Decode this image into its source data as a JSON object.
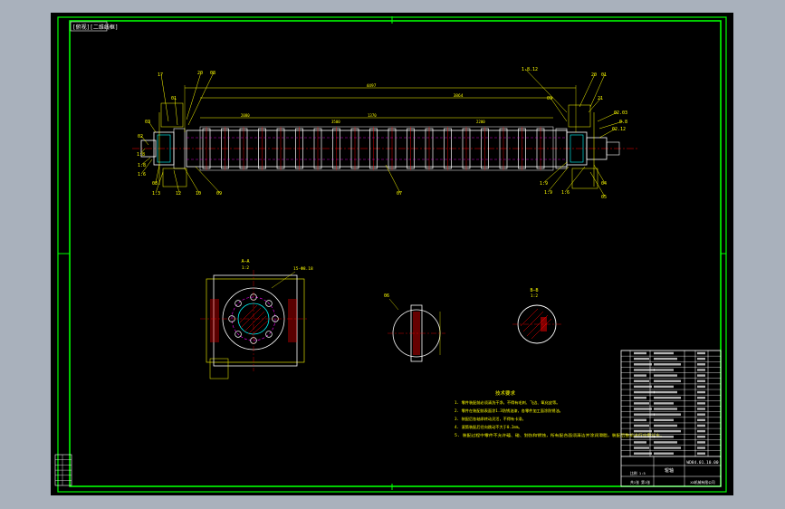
{
  "frame_label": "[俯视][二维线框]",
  "part_labels": [
    "17",
    "20",
    "08",
    "01",
    "03",
    "02",
    "1.8",
    "1.6",
    "08",
    "1.3",
    "12",
    "10",
    "09",
    "07",
    "1.9",
    "1.9",
    "1.6",
    "04",
    "05",
    "20",
    "21",
    "02.03",
    "0.8",
    "1.8.12",
    "09",
    "01",
    "02.12",
    "1.8"
  ],
  "dimensions": {
    "overall_length": "4497",
    "roller_length": "3864",
    "small_dims": [
      "2080",
      "1370",
      "3500",
      "2200"
    ]
  },
  "section_views": {
    "a_a_label": "A—A",
    "a_a_scale": "1:2",
    "b_b_label": "B—B",
    "b_b_scale": "1:2",
    "flange_note": "15-Φ8.18",
    "key_label": "06"
  },
  "tech_requirements": {
    "title": "技术要求",
    "items": [
      "1. 零件装配前必须清洗干净，不得有毛刺、飞边、氧化皮等。",
      "2. 零件在装配前表面涂1.3防锈油漆，各零件加工面涂防锈油。",
      "3. 装配后各轴承转动灵活，不得有卡滞。",
      "4. 滚筒装配后径向跳动不大于0.2mm。",
      "5. 装配过程中零件不允许磕、碰、划伤和锈蚀，所有配合面须清洁并涂润滑脂，装配后整机进行空载试车。"
    ]
  },
  "title_block": {
    "drawing_number": "WD84.01.10.00",
    "name": "辊轴",
    "scale_info": "比例  1:5",
    "sheet_info": "共1张  第1张",
    "company": "XX机械有限公司"
  },
  "colors": {
    "frame": "#00ff00",
    "part": "#ffffff",
    "leader": "#ffff00",
    "centerline": "#ff0000",
    "hidden": "#ff00ff",
    "cyan": "#00ffff"
  }
}
